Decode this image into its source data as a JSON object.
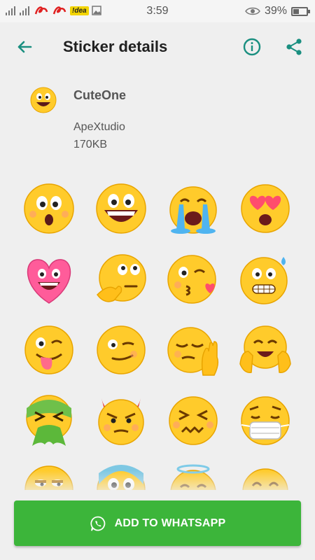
{
  "status_bar": {
    "carrier": "!dea",
    "time": "3:59",
    "battery": "39%"
  },
  "app_bar": {
    "title": "Sticker details",
    "back_icon": "arrow-left-icon",
    "info_icon": "info-icon",
    "share_icon": "share-icon"
  },
  "pack": {
    "name": "CuteOne",
    "author": "ApeXtudio",
    "size": "170KB"
  },
  "stickers": [
    {
      "name": "surprised-face"
    },
    {
      "name": "big-grin-face"
    },
    {
      "name": "loudly-crying-face"
    },
    {
      "name": "heart-eyes-face"
    },
    {
      "name": "laughing-heart"
    },
    {
      "name": "thinking-face"
    },
    {
      "name": "kissing-wink-face"
    },
    {
      "name": "grimacing-face"
    },
    {
      "name": "winking-tongue-face"
    },
    {
      "name": "smirking-wink-face"
    },
    {
      "name": "tired-hand-face"
    },
    {
      "name": "hugging-face"
    },
    {
      "name": "vomiting-face"
    },
    {
      "name": "devil-face"
    },
    {
      "name": "dizzy-face"
    },
    {
      "name": "mask-face"
    },
    {
      "name": "unamused-face"
    },
    {
      "name": "cold-face"
    },
    {
      "name": "angel-face"
    },
    {
      "name": "happy-face"
    }
  ],
  "cta": {
    "label": "ADD TO WHATSAPP",
    "icon": "whatsapp-icon"
  },
  "colors": {
    "accent": "#1a8f80",
    "cta_green": "#3cb53a",
    "emoji_yellow": "#ffcb2b"
  }
}
